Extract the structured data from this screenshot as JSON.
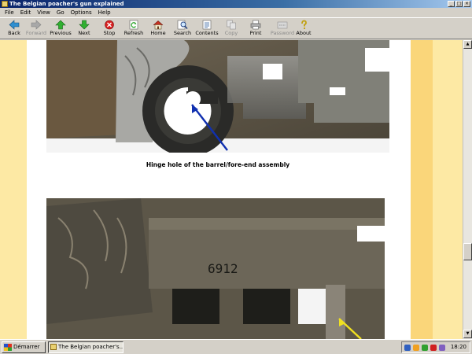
{
  "window": {
    "title": "The Belgian poacher's gun explained"
  },
  "menu": [
    "File",
    "Edit",
    "View",
    "Go",
    "Options",
    "Help"
  ],
  "toolbar": [
    {
      "label": "Back",
      "icon": "back-arrow-icon",
      "enabled": true
    },
    {
      "label": "Forward",
      "icon": "forward-arrow-icon",
      "enabled": false
    },
    {
      "label": "Previous",
      "icon": "previous-arrow-icon",
      "enabled": true
    },
    {
      "label": "Next",
      "icon": "next-arrow-icon",
      "enabled": true
    },
    {
      "label": "Stop",
      "icon": "stop-icon",
      "enabled": true
    },
    {
      "label": "Refresh",
      "icon": "refresh-icon",
      "enabled": true
    },
    {
      "label": "Home",
      "icon": "home-icon",
      "enabled": true
    },
    {
      "label": "Search",
      "icon": "search-icon",
      "enabled": true
    },
    {
      "label": "Contents",
      "icon": "contents-icon",
      "enabled": true
    },
    {
      "label": "Copy",
      "icon": "copy-icon",
      "enabled": false
    },
    {
      "label": "Print",
      "icon": "print-icon",
      "enabled": true
    },
    {
      "label": "Password",
      "icon": "password-icon",
      "enabled": false
    },
    {
      "label": "About",
      "icon": "about-icon",
      "enabled": true
    }
  ],
  "content": {
    "caption1": "Hinge hole of the barrel/fore-end assembly",
    "photo2_engraving": "6912"
  },
  "taskbar": {
    "start_label": "Démarrer",
    "task_item": "The Belgian poacher's...",
    "clock": "18:20"
  },
  "colors": {
    "page_stripe_light": "#fde9a4",
    "page_stripe_dark": "#fad67a",
    "arrow_photo1": "#1030b0",
    "arrow_photo2": "#f0e020"
  }
}
